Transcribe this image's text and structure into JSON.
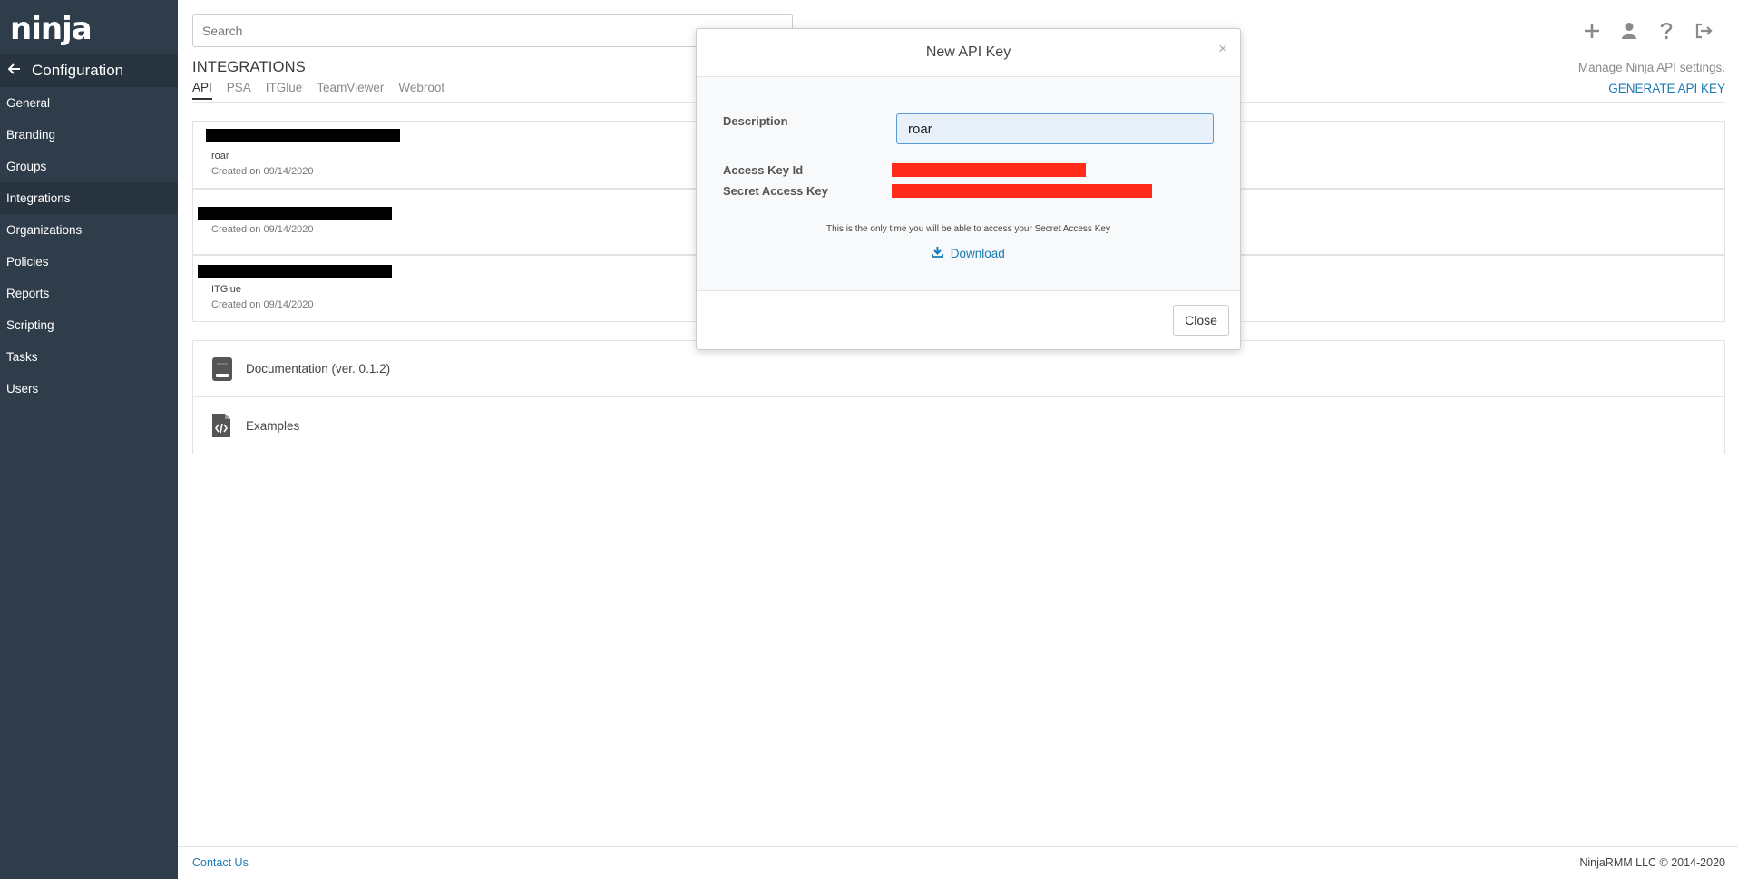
{
  "app": {
    "logo": "ninja"
  },
  "sidebar": {
    "header_label": "Configuration",
    "items": [
      {
        "label": "General",
        "active": false
      },
      {
        "label": "Branding",
        "active": false
      },
      {
        "label": "Groups",
        "active": false
      },
      {
        "label": "Integrations",
        "active": true
      },
      {
        "label": "Organizations",
        "active": false
      },
      {
        "label": "Policies",
        "active": false
      },
      {
        "label": "Reports",
        "active": false
      },
      {
        "label": "Scripting",
        "active": false
      },
      {
        "label": "Tasks",
        "active": false
      },
      {
        "label": "Users",
        "active": false
      }
    ]
  },
  "topbar": {
    "search": {
      "placeholder": "Search",
      "value": ""
    },
    "icons": [
      "plus-icon",
      "user-icon",
      "help-icon",
      "logout-icon"
    ]
  },
  "page": {
    "title": "INTEGRATIONS",
    "tabs": [
      {
        "label": "API",
        "active": true
      },
      {
        "label": "PSA",
        "active": false
      },
      {
        "label": "ITGlue",
        "active": false
      },
      {
        "label": "TeamViewer",
        "active": false
      },
      {
        "label": "Webroot",
        "active": false
      }
    ],
    "manage_text": "Manage Ninja API settings.",
    "generate_label": "GENERATE API KEY"
  },
  "api_keys": [
    {
      "description": "roar",
      "created": "Created on 09/14/2020"
    },
    {
      "description": "",
      "created": "Created on 09/14/2020"
    },
    {
      "description": "ITGlue",
      "created": "Created on 09/14/2020"
    }
  ],
  "resources": {
    "documentation": "Documentation (ver. 0.1.2)",
    "examples": "Examples"
  },
  "modal": {
    "title": "New API Key",
    "close_x": "×",
    "description_label": "Description",
    "description_value": "roar",
    "access_key_label": "Access Key Id",
    "secret_key_label": "Secret Access Key",
    "notice": "This is the only time you will be able to access your Secret Access Key",
    "download_label": "Download",
    "close_label": "Close"
  },
  "footer": {
    "contact": "Contact Us",
    "copyright": "NinjaRMM LLC © 2014-2020"
  },
  "colors": {
    "sidebar": "#2f3d4b",
    "link": "#1a7ab5",
    "redaction_red": "#ff2a1a"
  }
}
